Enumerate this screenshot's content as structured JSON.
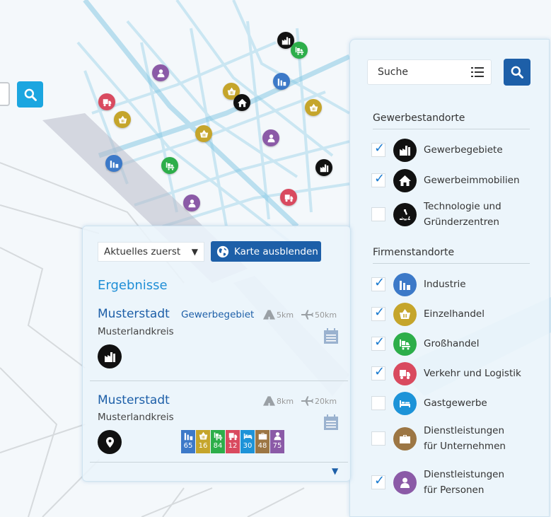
{
  "colors": {
    "industrie": "#3c79c8",
    "einzelhandel": "#c5a52b",
    "grosshandel": "#2dae4a",
    "verkehr": "#d94a5f",
    "gastgewerbe": "#1d93d8",
    "dienst_unternehmen": "#9c7644",
    "dienst_personen": "#8b5aa7",
    "black": "#111111",
    "primary": "#1d5fa8",
    "accent": "#1ba6e0"
  },
  "map_markers": [
    {
      "icon": "factory-icon",
      "color": "#111111"
    },
    {
      "icon": "forklift-icon",
      "color": "#2dae4a"
    },
    {
      "icon": "person-icon",
      "color": "#8b5aa7"
    },
    {
      "icon": "industry-icon",
      "color": "#3c79c8"
    },
    {
      "icon": "basket-icon",
      "color": "#c5a52b"
    },
    {
      "icon": "truck-icon",
      "color": "#d94a5f"
    },
    {
      "icon": "home-icon",
      "color": "#111111"
    },
    {
      "icon": "basket-icon",
      "color": "#c5a52b"
    },
    {
      "icon": "basket-icon",
      "color": "#c5a52b"
    },
    {
      "icon": "basket-icon",
      "color": "#c5a52b"
    },
    {
      "icon": "person-icon",
      "color": "#8b5aa7"
    },
    {
      "icon": "industry-icon",
      "color": "#3c79c8"
    },
    {
      "icon": "forklift-icon",
      "color": "#2dae4a"
    },
    {
      "icon": "factory-icon",
      "color": "#111111"
    },
    {
      "icon": "person-icon",
      "color": "#8b5aa7"
    },
    {
      "icon": "truck-icon",
      "color": "#d94a5f"
    }
  ],
  "filter": {
    "search_placeholder": "Suche",
    "section_gewerbe": "Gewerbestandorte",
    "section_firmen": "Firmenstandorte",
    "gewerbe_items": [
      {
        "label": "Gewerbegebiete",
        "checked": true,
        "icon": "factory-icon",
        "color": "#111111"
      },
      {
        "label": "Gewerbeimmobilien",
        "checked": true,
        "icon": "home-icon",
        "color": "#111111"
      },
      {
        "label": "Technologie und",
        "label2": "Gründerzentren",
        "checked": false,
        "icon": "microscope-icon",
        "color": "#111111"
      }
    ],
    "firmen_items": [
      {
        "label": "Industrie",
        "checked": true,
        "icon": "industry-icon",
        "color": "#3c79c8"
      },
      {
        "label": "Einzelhandel",
        "checked": true,
        "icon": "basket-icon",
        "color": "#c5a52b"
      },
      {
        "label": "Großhandel",
        "checked": true,
        "icon": "forklift-icon",
        "color": "#2dae4a"
      },
      {
        "label": "Verkehr und Logistik",
        "checked": true,
        "icon": "truck-icon",
        "color": "#d94a5f"
      },
      {
        "label": "Gastgewerbe",
        "checked": false,
        "icon": "bed-icon",
        "color": "#1d93d8"
      },
      {
        "label": "Dienstleistungen",
        "label2": "für Unternehmen",
        "checked": false,
        "icon": "briefcase-icon",
        "color": "#9c7644"
      },
      {
        "label": "Dienstleistungen",
        "label2": "für Personen",
        "checked": true,
        "icon": "person-icon",
        "color": "#8b5aa7"
      }
    ]
  },
  "results": {
    "sort_label": "Aktuelles zuerst",
    "hide_map_label": "Karte ausblenden",
    "title": "Ergebnisse",
    "items": [
      {
        "title": "Musterstadt",
        "type": "Gewerbegebiet",
        "subtitle": "Musterlandkreis",
        "road_km": "5km",
        "air_km": "50km",
        "icon": "factory-icon"
      },
      {
        "title": "Musterstadt",
        "type": "",
        "subtitle": "Musterlandkreis",
        "road_km": "8km",
        "air_km": "20km",
        "icon": "location-pin-icon"
      }
    ],
    "counts": [
      {
        "icon": "industry-icon",
        "color": "#3c79c8",
        "value": "65"
      },
      {
        "icon": "basket-icon",
        "color": "#c5a52b",
        "value": "16"
      },
      {
        "icon": "forklift-icon",
        "color": "#2dae4a",
        "value": "84"
      },
      {
        "icon": "truck-icon",
        "color": "#d94a5f",
        "value": "12"
      },
      {
        "icon": "bed-icon",
        "color": "#1d93d8",
        "value": "30"
      },
      {
        "icon": "briefcase-icon",
        "color": "#9c7644",
        "value": "48"
      },
      {
        "icon": "person-icon",
        "color": "#8b5aa7",
        "value": "75"
      }
    ]
  }
}
